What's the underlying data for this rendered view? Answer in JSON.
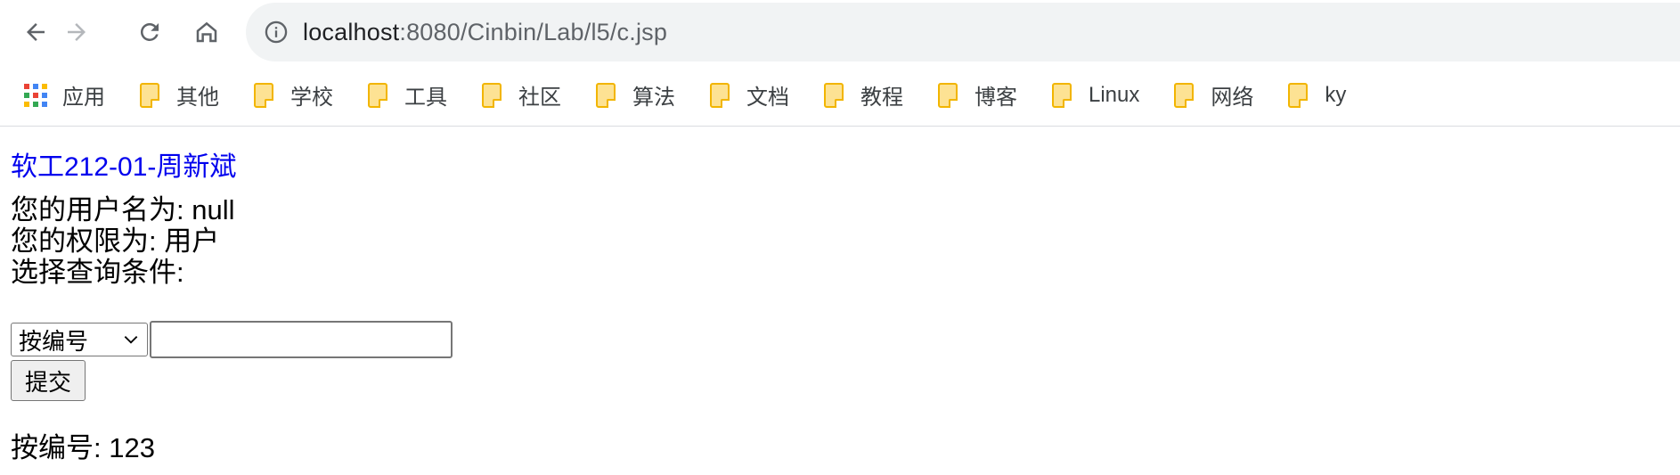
{
  "browser": {
    "url_host": "localhost",
    "url_path": ":8080/Cinbin/Lab/l5/c.jsp"
  },
  "bookmarks": {
    "items": [
      {
        "label": "应用",
        "icon": "apps-grid-icon"
      },
      {
        "label": "其他",
        "icon": "folder-icon"
      },
      {
        "label": "学校",
        "icon": "folder-icon"
      },
      {
        "label": "工具",
        "icon": "folder-icon"
      },
      {
        "label": "社区",
        "icon": "folder-icon"
      },
      {
        "label": "算法",
        "icon": "folder-icon"
      },
      {
        "label": "文档",
        "icon": "folder-icon"
      },
      {
        "label": "教程",
        "icon": "folder-icon"
      },
      {
        "label": "博客",
        "icon": "folder-icon"
      },
      {
        "label": "Linux",
        "icon": "folder-icon"
      },
      {
        "label": "网络",
        "icon": "folder-icon"
      },
      {
        "label": "ky",
        "icon": "folder-icon"
      }
    ]
  },
  "page": {
    "heading": "软工212-01-周新斌",
    "username_line": "您的用户名为: null",
    "permission_line": "您的权限为: 用户",
    "query_prompt": "选择查询条件:",
    "select_value": "按编号",
    "input_value": "",
    "submit_label": "提交",
    "result_line": "按编号: 123"
  },
  "colors": {
    "heading_link": "#0000ee",
    "omnibox_bg": "#f1f3f4",
    "folder_fill": "#fde293"
  }
}
